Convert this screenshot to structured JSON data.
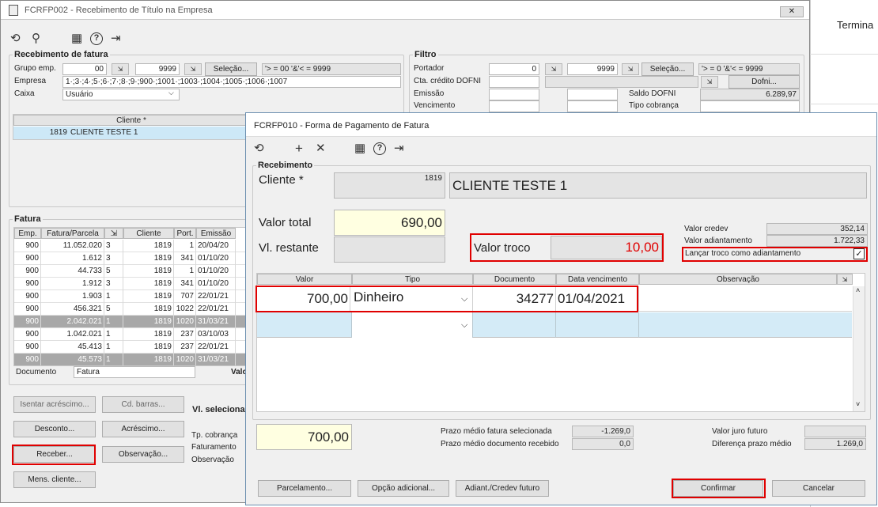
{
  "main_window": {
    "title": "FCRFP002 - Recebimento de Título na Empresa",
    "close_icon": "✕",
    "toolbar": {
      "icons": [
        "refresh-icon",
        "search-icon",
        "calendar-icon",
        "help-icon",
        "exit-icon"
      ],
      "glyphs": [
        "⟲",
        "⚲",
        "▦",
        "?",
        "⇥"
      ]
    },
    "recebimento": {
      "title": "Recebimento de fatura",
      "grupo_label": "Grupo emp.",
      "grupo_from": "00",
      "grupo_to": "9999",
      "selecao": "Seleção...",
      "grupo_range": "'> = 00 '&'< = 9999",
      "empresa_label": "Empresa",
      "empresa_value": "1·;3·;4·;5·;6·;7·;8·;9·;900·;1001·;1003·;1004·;1005·;1006·;1007",
      "caixa_label": "Caixa",
      "caixa_value": "Usuário"
    },
    "filtro": {
      "title": "Filtro",
      "portador_label": "Portador",
      "portador_from": "0",
      "portador_to": "9999",
      "selecao": "Seleção...",
      "portador_range": "'> = 0 '&'< = 9999",
      "cta_label": "Cta. crédito DOFNI",
      "dofni_button": "Dofni...",
      "emissao_label": "Emissão",
      "saldo_label": "Saldo DOFNI",
      "saldo_value": "6.289,97",
      "vencimento_label": "Vencimento",
      "tipo_cobranca_label": "Tipo cobrança"
    },
    "clients": {
      "header": "Cliente *",
      "rows": [
        {
          "code": "1819",
          "name": "CLIENTE TESTE 1"
        }
      ]
    },
    "fatura": {
      "title": "Fatura",
      "columns": [
        "Emp.",
        "Fatura/Parcela",
        "⇲",
        "Cliente",
        "Port.",
        "Emissão"
      ],
      "rows": [
        {
          "emp": "900",
          "fatura": "11.052.020",
          "parc": "3",
          "cliente": "1819",
          "port": "1",
          "emissao": "20/04/20",
          "sel": false
        },
        {
          "emp": "900",
          "fatura": "1.612",
          "parc": "3",
          "cliente": "1819",
          "port": "341",
          "emissao": "01/10/20",
          "sel": false
        },
        {
          "emp": "900",
          "fatura": "44.733",
          "parc": "5",
          "cliente": "1819",
          "port": "1",
          "emissao": "01/10/20",
          "sel": false
        },
        {
          "emp": "900",
          "fatura": "1.912",
          "parc": "3",
          "cliente": "1819",
          "port": "341",
          "emissao": "01/10/20",
          "sel": false
        },
        {
          "emp": "900",
          "fatura": "1.903",
          "parc": "1",
          "cliente": "1819",
          "port": "707",
          "emissao": "22/01/21",
          "sel": false
        },
        {
          "emp": "900",
          "fatura": "456.321",
          "parc": "5",
          "cliente": "1819",
          "port": "1022",
          "emissao": "22/01/21",
          "sel": false
        },
        {
          "emp": "900",
          "fatura": "2.042.021",
          "parc": "1",
          "cliente": "1819",
          "port": "1020",
          "emissao": "31/03/21",
          "sel": true
        },
        {
          "emp": "900",
          "fatura": "1.042.021",
          "parc": "1",
          "cliente": "1819",
          "port": "237",
          "emissao": "03/10/03",
          "sel": false
        },
        {
          "emp": "900",
          "fatura": "45.413",
          "parc": "1",
          "cliente": "1819",
          "port": "237",
          "emissao": "22/01/21",
          "sel": false
        },
        {
          "emp": "900",
          "fatura": "45.573",
          "parc": "1",
          "cliente": "1819",
          "port": "1020",
          "emissao": "31/03/21",
          "sel": true
        }
      ],
      "documento_label": "Documento",
      "documento_value": "Fatura",
      "val_label": "Valo"
    },
    "buttons": {
      "isentar": "Isentar acréscimo...",
      "cd_barras": "Cd. barras...",
      "desconto": "Desconto...",
      "acrescimo": "Acréscimo...",
      "receber": "Receber...",
      "observacao": "Observação...",
      "mens_cliente": "Mens. cliente..."
    },
    "vl_selecionado": "Vl. seleciona",
    "tp_cobranca": "Tp. cobrança",
    "faturamento": "Faturamento",
    "observacao_lbl": "Observação"
  },
  "background_text": "Termina",
  "dialog": {
    "title": "FCRFP010 - Forma de Pagamento de Fatura",
    "toolbar": {
      "icons": [
        "refresh-icon",
        "add-icon",
        "delete-icon",
        "calendar-icon",
        "help-icon",
        "exit-icon"
      ],
      "glyphs": [
        "⟲",
        "+",
        "✕",
        "▦",
        "?",
        "⇥"
      ]
    },
    "recebimento_title": "Recebimento",
    "cliente_label": "Cliente *",
    "cliente_code": "1819",
    "cliente_name": "CLIENTE TESTE 1",
    "valor_total_label": "Valor total",
    "valor_total": "690,00",
    "vl_restante_label": "Vl. restante",
    "valor_troco_label": "Valor troco",
    "valor_troco": "10,00",
    "valor_credev_label": "Valor credev",
    "valor_credev": "352,14",
    "valor_adiant_label": "Valor adiantamento",
    "valor_adiant": "1.722,33",
    "lancar_label": "Lançar troco como adiantamento",
    "lancar_checked": "✓",
    "grid": {
      "columns": [
        "Valor",
        "Tipo",
        "Documento",
        "Data vencimento",
        "Observação"
      ],
      "rows": [
        {
          "valor": "700,00",
          "tipo": "Dinheiro",
          "documento": "34277",
          "data": "01/04/2021",
          "obs": ""
        }
      ]
    },
    "total_value": "700,00",
    "prazo_fatura_label": "Prazo médio fatura selecionada",
    "prazo_fatura": "-1.269,0",
    "prazo_doc_label": "Prazo médio documento recebido",
    "prazo_doc": "0,0",
    "juro_label": "Valor juro futuro",
    "juro": "",
    "dif_label": "Diferença prazo médio",
    "dif": "1.269,0",
    "buttons": {
      "parcelamento": "Parcelamento...",
      "opcao": "Opção adicional...",
      "adiant": "Adiant./Credev futuro",
      "confirmar": "Confirmar",
      "cancelar": "Cancelar"
    }
  }
}
